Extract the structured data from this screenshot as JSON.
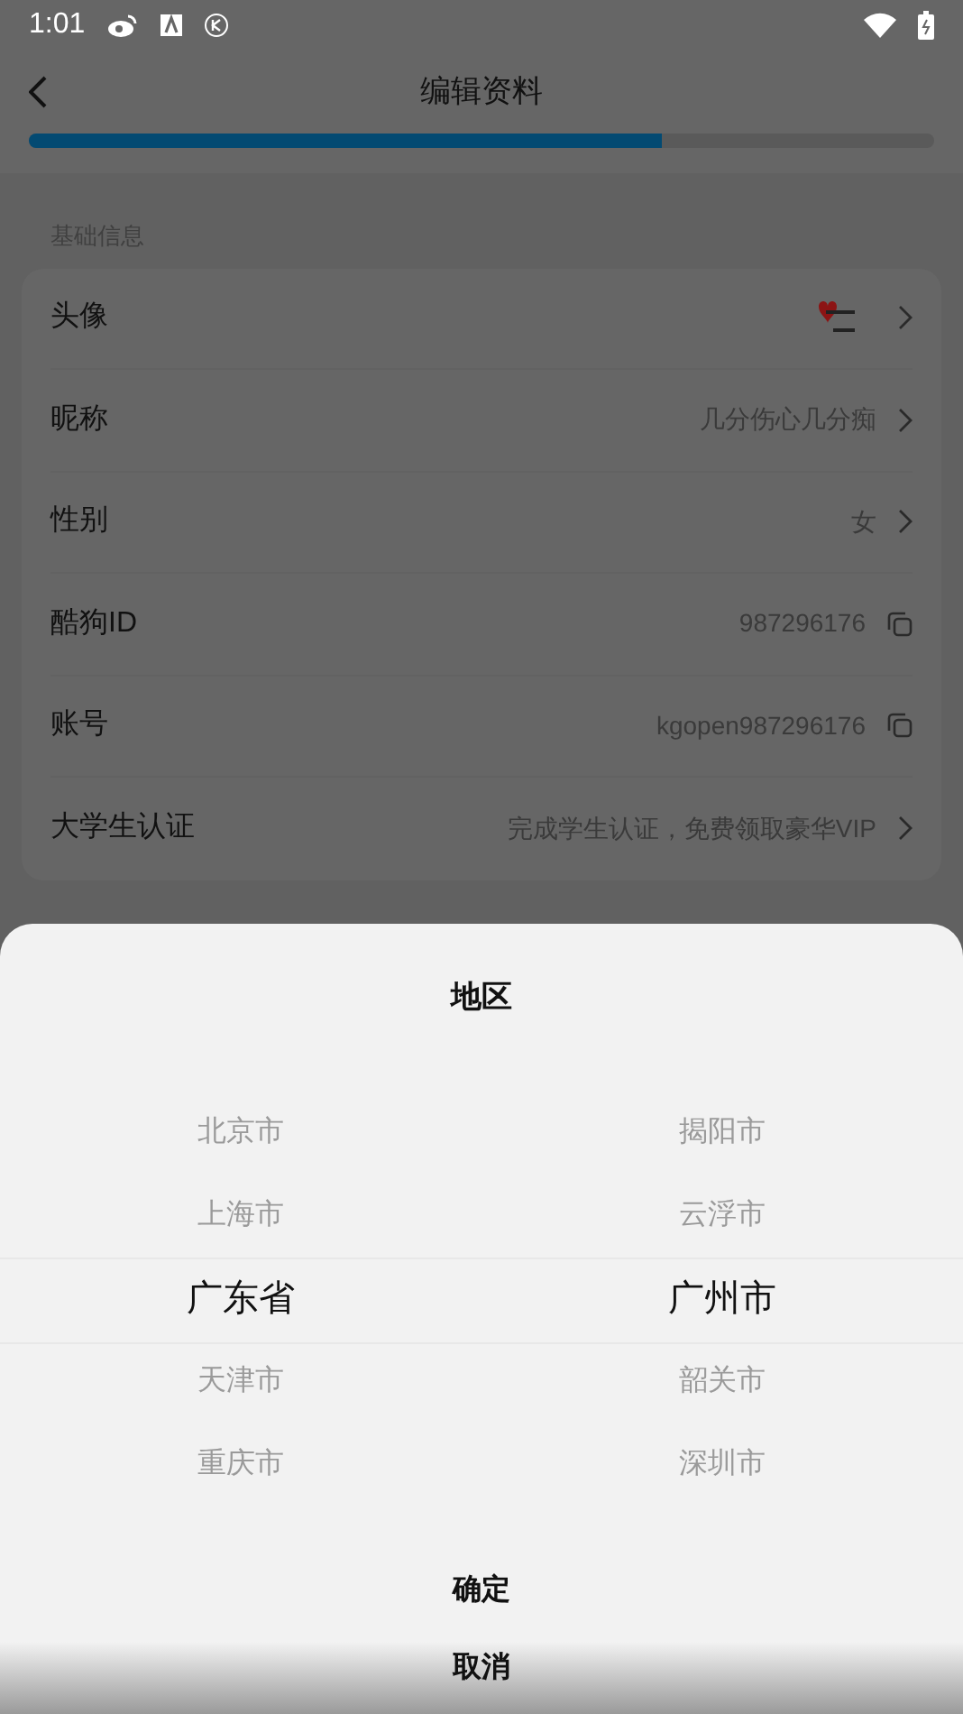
{
  "status_bar": {
    "time": "1:01"
  },
  "header": {
    "title": "编辑资料"
  },
  "progress": {
    "level": 0.7
  },
  "section": {
    "title": "基础信息"
  },
  "rows": [
    {
      "label": "头像",
      "kind": "avatar"
    },
    {
      "label": "昵称",
      "value": "几分伤心几分痴",
      "kind": "link"
    },
    {
      "label": "性别",
      "value": "女",
      "kind": "link"
    },
    {
      "label": "酷狗ID",
      "value": "987296176",
      "kind": "copy"
    },
    {
      "label": "账号",
      "value": "kgopen987296176",
      "kind": "copy"
    },
    {
      "label": "大学生认证",
      "value": "完成学生认证，免费领取豪华VIP",
      "kind": "link"
    }
  ],
  "sheet": {
    "title": "地区",
    "columns": [
      [
        {
          "label": "北京市",
          "selected": false
        },
        {
          "label": "上海市",
          "selected": false
        },
        {
          "label": "广东省",
          "selected": true
        },
        {
          "label": "天津市",
          "selected": false
        },
        {
          "label": "重庆市",
          "selected": false
        }
      ],
      [
        {
          "label": "揭阳市",
          "selected": false
        },
        {
          "label": "云浮市",
          "selected": false
        },
        {
          "label": "广州市",
          "selected": true
        },
        {
          "label": "韶关市",
          "selected": false
        },
        {
          "label": "深圳市",
          "selected": false
        }
      ]
    ],
    "confirm": "确定",
    "cancel": "取消"
  }
}
